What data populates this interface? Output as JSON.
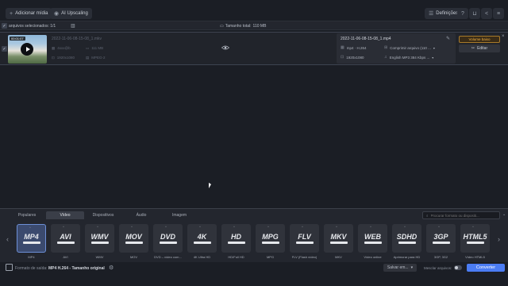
{
  "toolbar": {
    "add_media": "Adicionar mídia",
    "ai_upscaling": "AI Upscaling",
    "settings": "Definições"
  },
  "selection": {
    "selected_label": "arquivos selecionados:",
    "selected_count": "1/1",
    "total_label": "Tamanho total:",
    "total_value": "110 MB"
  },
  "file": {
    "duration": "00:01:07",
    "name": "2022-11-06-08-15-08_1.mkv",
    "info": [
      "4xxx@b",
      "111 MB",
      "1920x1080",
      "MPEG-2"
    ],
    "output": {
      "name": "2022-11-06-08-15-08_1.mp4",
      "codec": "mp4 · H.264",
      "compress": "Comprimir arquivo (110 ...",
      "resolution": "1920x1080",
      "audio": "English MP3 384 Kbps ..."
    },
    "volume_button": "Volume baixo",
    "edit_button": "Editar"
  },
  "formats": {
    "tabs": [
      "Populares",
      "Vídeo",
      "Dispositivos",
      "Áudio",
      "Imagem"
    ],
    "active_tab": 1,
    "search_placeholder": "Procurar formato ou dispositi...",
    "items": [
      {
        "mark": "MP4",
        "label": "MP4",
        "selected": true
      },
      {
        "mark": "AVI",
        "label": "AVI"
      },
      {
        "mark": "WMV",
        "label": "WMV"
      },
      {
        "mark": "MOV",
        "label": "MOV"
      },
      {
        "mark": "DVD",
        "label": "DVD – vídeo com..."
      },
      {
        "mark": "4K",
        "label": "4K Ultra HD"
      },
      {
        "mark": "HD",
        "label": "HD/Full HD"
      },
      {
        "mark": "MPG",
        "label": "MPG"
      },
      {
        "mark": "FLV",
        "label": "FLV (Flash vídeo)"
      },
      {
        "mark": "MKV",
        "label": "MKV"
      },
      {
        "mark": "WEB",
        "label": "Vídeo online"
      },
      {
        "mark": "SDHD",
        "label": "Aprimorar para HD"
      },
      {
        "mark": "3GP",
        "label": "3GP, 3G2"
      },
      {
        "mark": "HTML5",
        "label": "Vídeo HTML5"
      }
    ]
  },
  "bottom": {
    "output_label": "Formato de saída:",
    "output_value": "MP4 H.264 - Tamanho original",
    "save_to": "Salvar em...",
    "merge_label": "Mesclar arquivos:",
    "convert": "Converter"
  }
}
